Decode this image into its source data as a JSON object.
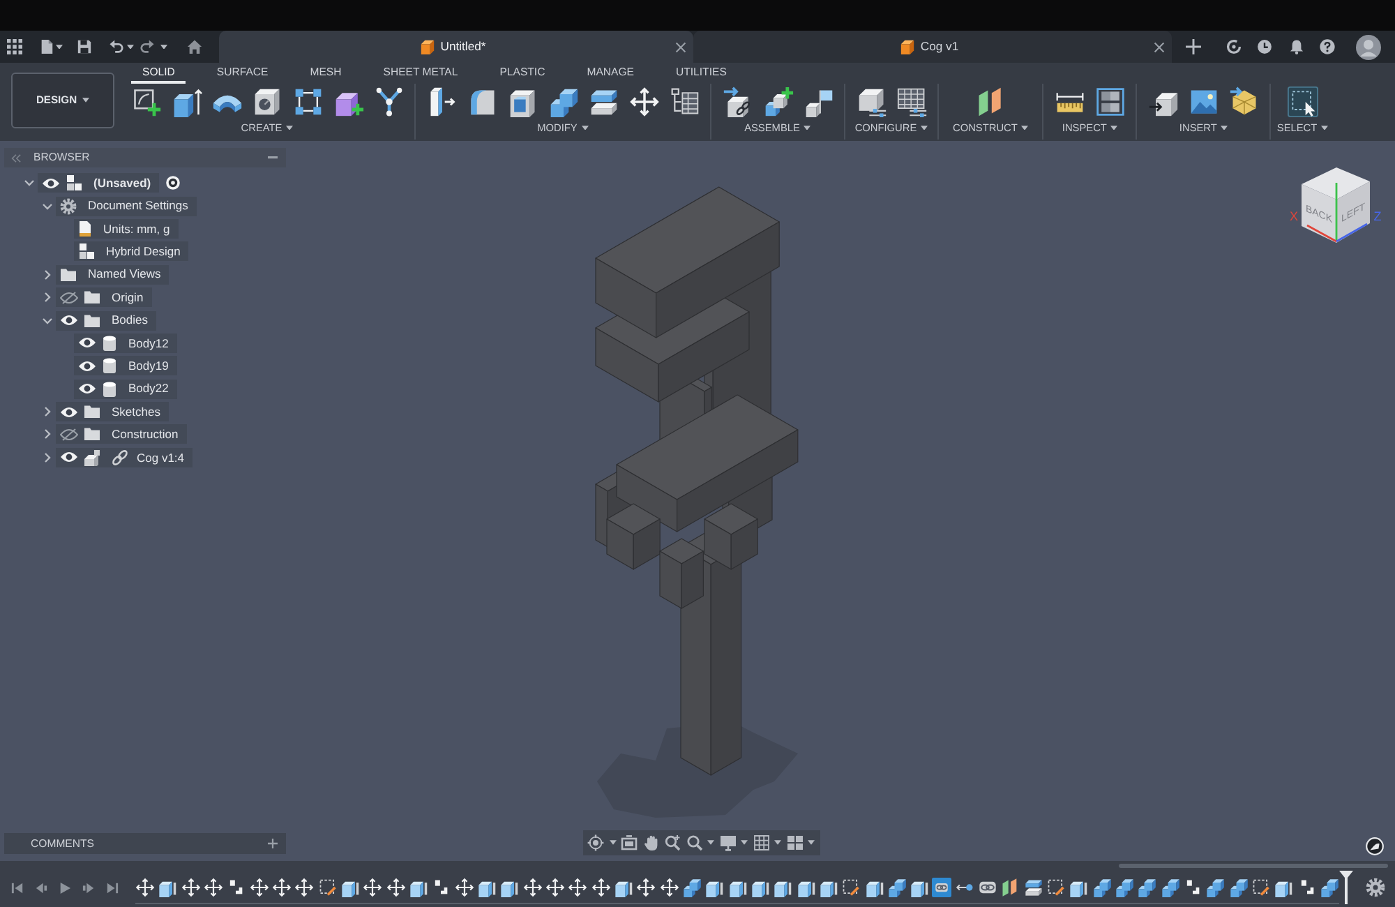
{
  "tabs": [
    {
      "label": "Untitled*",
      "selected": true
    },
    {
      "label": "Cog v1",
      "selected": false
    }
  ],
  "workspace": {
    "label": "DESIGN"
  },
  "ribbon_tabs": [
    {
      "label": "SOLID",
      "selected": true
    },
    {
      "label": "SURFACE",
      "selected": false
    },
    {
      "label": "MESH",
      "selected": false
    },
    {
      "label": "SHEET METAL",
      "selected": false
    },
    {
      "label": "PLASTIC",
      "selected": false
    },
    {
      "label": "MANAGE",
      "selected": false
    },
    {
      "label": "UTILITIES",
      "selected": false
    }
  ],
  "tool_groups": [
    {
      "label": "CREATE",
      "tools": [
        {
          "kind": "sketch"
        },
        {
          "kind": "extrude"
        },
        {
          "kind": "revolve"
        },
        {
          "kind": "hole"
        },
        {
          "kind": "pattern"
        },
        {
          "kind": "form"
        },
        {
          "kind": "derive"
        }
      ]
    },
    {
      "label": "MODIFY",
      "tools": [
        {
          "kind": "press-pull"
        },
        {
          "kind": "fillet"
        },
        {
          "kind": "shell"
        },
        {
          "kind": "combine"
        },
        {
          "kind": "split"
        },
        {
          "kind": "move"
        },
        {
          "kind": "parameters"
        }
      ]
    },
    {
      "label": "ASSEMBLE",
      "tools": [
        {
          "kind": "new-component"
        },
        {
          "kind": "joint"
        },
        {
          "kind": "as-built"
        }
      ]
    },
    {
      "label": "CONFIGURE",
      "tools": [
        {
          "kind": "configure"
        },
        {
          "kind": "configuration-table"
        }
      ]
    },
    {
      "label": "CONSTRUCT",
      "tools": [
        {
          "kind": "plane"
        }
      ]
    },
    {
      "label": "INSPECT",
      "tools": [
        {
          "kind": "measure"
        },
        {
          "kind": "section"
        }
      ]
    },
    {
      "label": "INSERT",
      "tools": [
        {
          "kind": "insert-derive"
        },
        {
          "kind": "canvas"
        },
        {
          "kind": "insert-mesh"
        }
      ]
    },
    {
      "label": "SELECT",
      "tools": [
        {
          "kind": "select"
        }
      ]
    }
  ],
  "browser": {
    "title": "BROWSER",
    "items": [
      {
        "label": "(Unsaved)",
        "kind": "root",
        "expanded": true,
        "visible": true,
        "active": true,
        "children": [
          {
            "label": "Document Settings",
            "kind": "settings",
            "expanded": true,
            "children": [
              {
                "label": "Units: mm, g",
                "kind": "document"
              },
              {
                "label": "Hybrid Design",
                "kind": "design-type"
              }
            ]
          },
          {
            "label": "Named Views",
            "kind": "folder",
            "expanded": false
          },
          {
            "label": "Origin",
            "kind": "folder",
            "expanded": false,
            "visible": false
          },
          {
            "label": "Bodies",
            "kind": "folder",
            "expanded": true,
            "visible": true,
            "children": [
              {
                "label": "Body12",
                "kind": "body",
                "visible": true
              },
              {
                "label": "Body19",
                "kind": "body",
                "visible": true
              },
              {
                "label": "Body22",
                "kind": "body",
                "visible": true
              }
            ]
          },
          {
            "label": "Sketches",
            "kind": "folder",
            "expanded": false,
            "visible": true
          },
          {
            "label": "Construction",
            "kind": "folder",
            "expanded": false,
            "visible": false
          },
          {
            "label": "Cog v1:4",
            "kind": "component",
            "expanded": false,
            "visible": true,
            "linked": true
          }
        ]
      }
    ]
  },
  "view_cube": {
    "face_labels": [
      "BACK",
      "LEFT"
    ],
    "axis_labels": [
      "X",
      "Z"
    ]
  },
  "comments": {
    "title": "COMMENTS"
  },
  "timeline": {
    "items": [
      {
        "kind": "move",
        "selected": false
      },
      {
        "kind": "body",
        "selected": false
      },
      {
        "kind": "move",
        "selected": false
      },
      {
        "kind": "move",
        "selected": false
      },
      {
        "kind": "joint",
        "selected": false
      },
      {
        "kind": "move",
        "selected": false
      },
      {
        "kind": "move",
        "selected": false
      },
      {
        "kind": "move",
        "selected": false
      },
      {
        "kind": "sketch",
        "selected": false
      },
      {
        "kind": "body",
        "selected": false
      },
      {
        "kind": "move",
        "selected": false
      },
      {
        "kind": "move",
        "selected": false
      },
      {
        "kind": "body",
        "selected": false
      },
      {
        "kind": "joint",
        "selected": false
      },
      {
        "kind": "move",
        "selected": false
      },
      {
        "kind": "body",
        "selected": false
      },
      {
        "kind": "body",
        "selected": false
      },
      {
        "kind": "move",
        "selected": false
      },
      {
        "kind": "move",
        "selected": false
      },
      {
        "kind": "move",
        "selected": false
      },
      {
        "kind": "move",
        "selected": false
      },
      {
        "kind": "body",
        "selected": false
      },
      {
        "kind": "move",
        "selected": false
      },
      {
        "kind": "move",
        "selected": false
      },
      {
        "kind": "combine",
        "selected": false
      },
      {
        "kind": "body",
        "selected": false
      },
      {
        "kind": "body",
        "selected": false
      },
      {
        "kind": "body",
        "selected": false
      },
      {
        "kind": "body",
        "selected": false
      },
      {
        "kind": "body",
        "selected": false
      },
      {
        "kind": "body",
        "selected": false
      },
      {
        "kind": "sketch",
        "selected": false
      },
      {
        "kind": "body",
        "selected": false
      },
      {
        "kind": "combine",
        "selected": false
      },
      {
        "kind": "body",
        "selected": false
      },
      {
        "kind": "rigid",
        "selected": true
      },
      {
        "kind": "joint-arrow",
        "selected": false
      },
      {
        "kind": "rigid",
        "selected": false
      },
      {
        "kind": "plane",
        "selected": false
      },
      {
        "kind": "split",
        "selected": false
      },
      {
        "kind": "sketch",
        "selected": false
      },
      {
        "kind": "body",
        "selected": false
      },
      {
        "kind": "combine",
        "selected": false
      },
      {
        "kind": "combine",
        "selected": false
      },
      {
        "kind": "combine",
        "selected": false
      },
      {
        "kind": "combine",
        "selected": false
      },
      {
        "kind": "joint",
        "selected": false
      },
      {
        "kind": "combine",
        "selected": false
      },
      {
        "kind": "combine",
        "selected": false
      },
      {
        "kind": "sketch",
        "selected": false
      },
      {
        "kind": "body",
        "selected": false
      },
      {
        "kind": "joint",
        "selected": false
      },
      {
        "kind": "combine",
        "selected": false
      }
    ]
  }
}
